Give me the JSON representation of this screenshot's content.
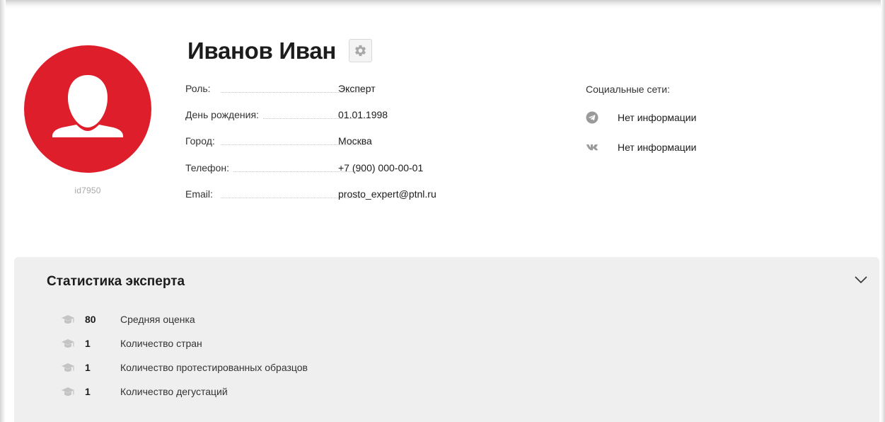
{
  "profile": {
    "name": "Иванов Иван",
    "user_id": "id7950",
    "avatar_color": "#de1e2a",
    "settings_icon": "gear-icon"
  },
  "info": {
    "role_label": "Роль:",
    "role_value": "Эксперт",
    "birthday_label": "День рождения:",
    "birthday_value": "01.01.1998",
    "city_label": "Город:",
    "city_value": "Москва",
    "phone_label": "Телефон:",
    "phone_value": "+7 (900) 000-00-01",
    "email_label": "Email:",
    "email_value": "prosto_expert@ptnl.ru"
  },
  "social": {
    "title": "Социальные сети:",
    "items": [
      {
        "icon": "telegram-icon",
        "text": "Нет информации"
      },
      {
        "icon": "vk-icon",
        "text": "Нет информации"
      }
    ]
  },
  "stats": {
    "title": "Статистика эксперта",
    "toggle_icon": "chevron-down-icon",
    "items": [
      {
        "icon": "graduation-cap-icon",
        "value": "80",
        "label": "Средняя оценка"
      },
      {
        "icon": "graduation-cap-icon",
        "value": "1",
        "label": "Количество стран"
      },
      {
        "icon": "graduation-cap-icon",
        "value": "1",
        "label": "Количество протестированных образцов"
      },
      {
        "icon": "graduation-cap-icon",
        "value": "1",
        "label": "Количество дегустаций"
      }
    ]
  },
  "colors": {
    "accent_red": "#de1e2a",
    "panel_bg": "#efefef",
    "icon_gray": "#9a9a9a"
  }
}
